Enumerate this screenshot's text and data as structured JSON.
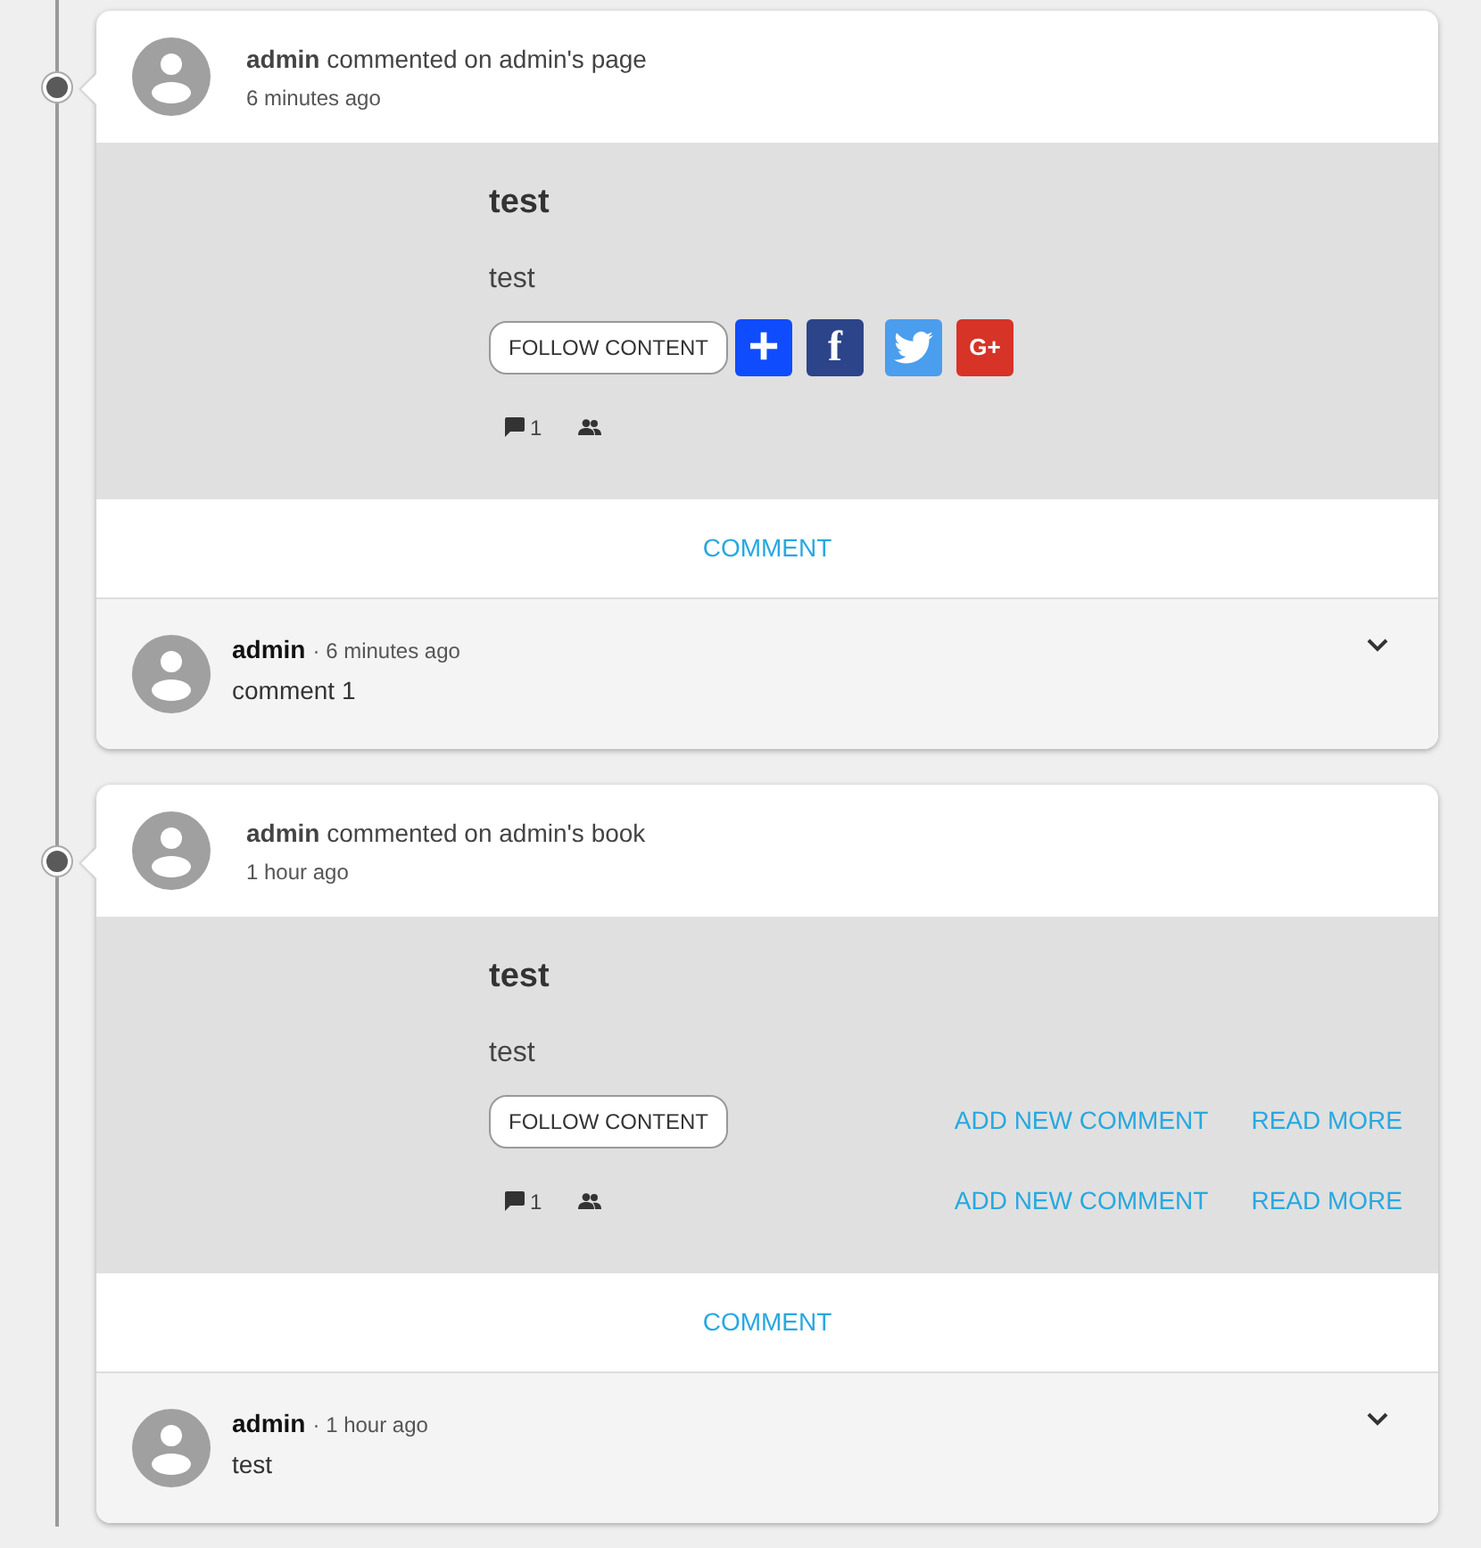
{
  "activities": [
    {
      "headline": "**admin** commented on admin's page",
      "time": "6 minutes ago",
      "title": "test",
      "body": "test",
      "follow_label": "FOLLOW CONTENT",
      "share": [
        {
          "kind": "addthis",
          "label": "+"
        },
        {
          "kind": "facebook",
          "label": "f"
        },
        {
          "kind": "twitter"
        },
        {
          "kind": "google",
          "label": "G+"
        }
      ],
      "comment_count": "1",
      "comment_button": "COMMENT",
      "comments": [
        {
          "author": "admin",
          "time": "· 6 minutes ago",
          "text": "comment 1"
        }
      ]
    },
    {
      "headline": "**admin** commented on admin's book",
      "time": "1 hour ago",
      "title": "test",
      "body": "test",
      "follow_label": "FOLLOW CONTENT",
      "comment_count": "1",
      "top_links": [
        "ADD NEW COMMENT",
        "READ MORE"
      ],
      "bottom_links": [
        "ADD NEW COMMENT",
        "READ MORE"
      ],
      "comment_button": "COMMENT",
      "comments": [
        {
          "author": "admin",
          "time": "· 1 hour ago",
          "text": "test"
        }
      ]
    }
  ]
}
